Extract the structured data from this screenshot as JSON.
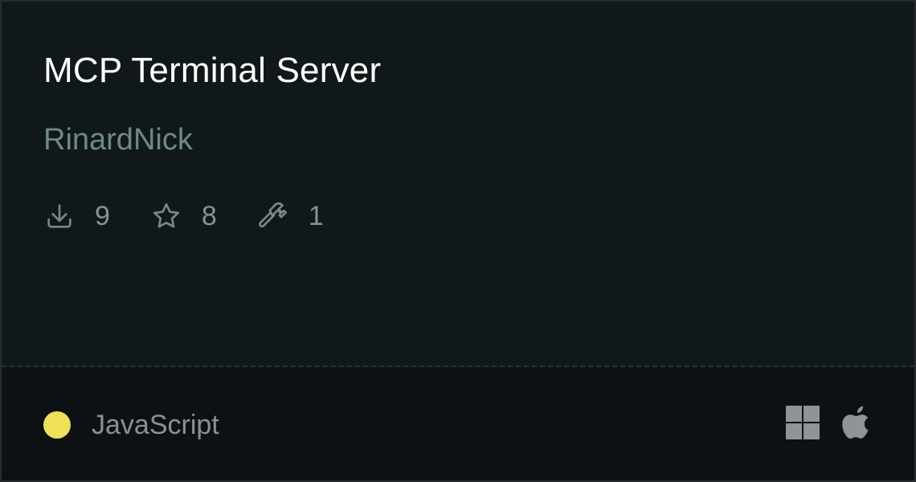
{
  "card": {
    "title": "MCP Terminal Server",
    "author": "RinardNick",
    "stats": {
      "downloads": {
        "icon": "download-icon",
        "value": "9"
      },
      "stars": {
        "icon": "star-icon",
        "value": "8"
      },
      "tools": {
        "icon": "hammer-icon",
        "value": "1"
      }
    },
    "language": {
      "name": "JavaScript",
      "color": "#f1e05a"
    },
    "platforms": [
      "windows-icon",
      "apple-icon"
    ]
  }
}
